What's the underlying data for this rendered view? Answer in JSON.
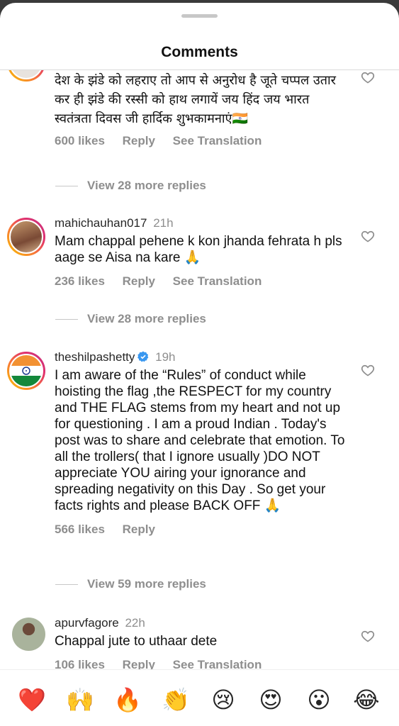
{
  "header": {
    "title": "Comments"
  },
  "comments": [
    {
      "text": "देश के झंडे को लहराए तो आप से अनुरोध है जूते चप्पल उतार कर ही झंडे की रस्सी को हाथ लगायें जय हिंद जय भारत स्वतंत्रता दिवस जी हार्दिक शुभकामनाएं🇮🇳",
      "likes": "600 likes",
      "reply": "Reply",
      "translate": "See Translation",
      "view_replies": "View 28 more replies"
    },
    {
      "username": "mahichauhan017",
      "time": "21h",
      "text": "Mam chappal pehene k kon jhanda fehrata h pls aage se Aisa na kare 🙏",
      "likes": "236 likes",
      "reply": "Reply",
      "translate": "See Translation",
      "view_replies": "View 28 more replies"
    },
    {
      "username": "theshilpashetty",
      "time": "19h",
      "text": "I am aware of the “Rules”  of conduct while hoisting the flag ,the RESPECT for my country and THE FLAG stems from my heart and not up for questioning . I am a proud Indian . Today's post was to share and celebrate that emotion. To all the trollers( that I ignore usually )DO NOT appreciate YOU airing your ignorance and spreading negativity on this Day . So get your facts rights and  please BACK OFF 🙏",
      "likes": "566 likes",
      "reply": "Reply",
      "view_replies": "View 59 more replies"
    },
    {
      "username": "apurvfagore",
      "time": "22h",
      "text": "Chappal jute to uthaar dete",
      "likes": "106 likes",
      "reply": "Reply",
      "translate": "See Translation"
    }
  ],
  "reactions": [
    "❤️",
    "🙌",
    "🔥",
    "👏",
    "😢",
    "😍",
    "😮",
    "😂"
  ],
  "colors": {
    "text": "#262626",
    "muted": "#8e8e8e",
    "verified": "#3897f0"
  }
}
